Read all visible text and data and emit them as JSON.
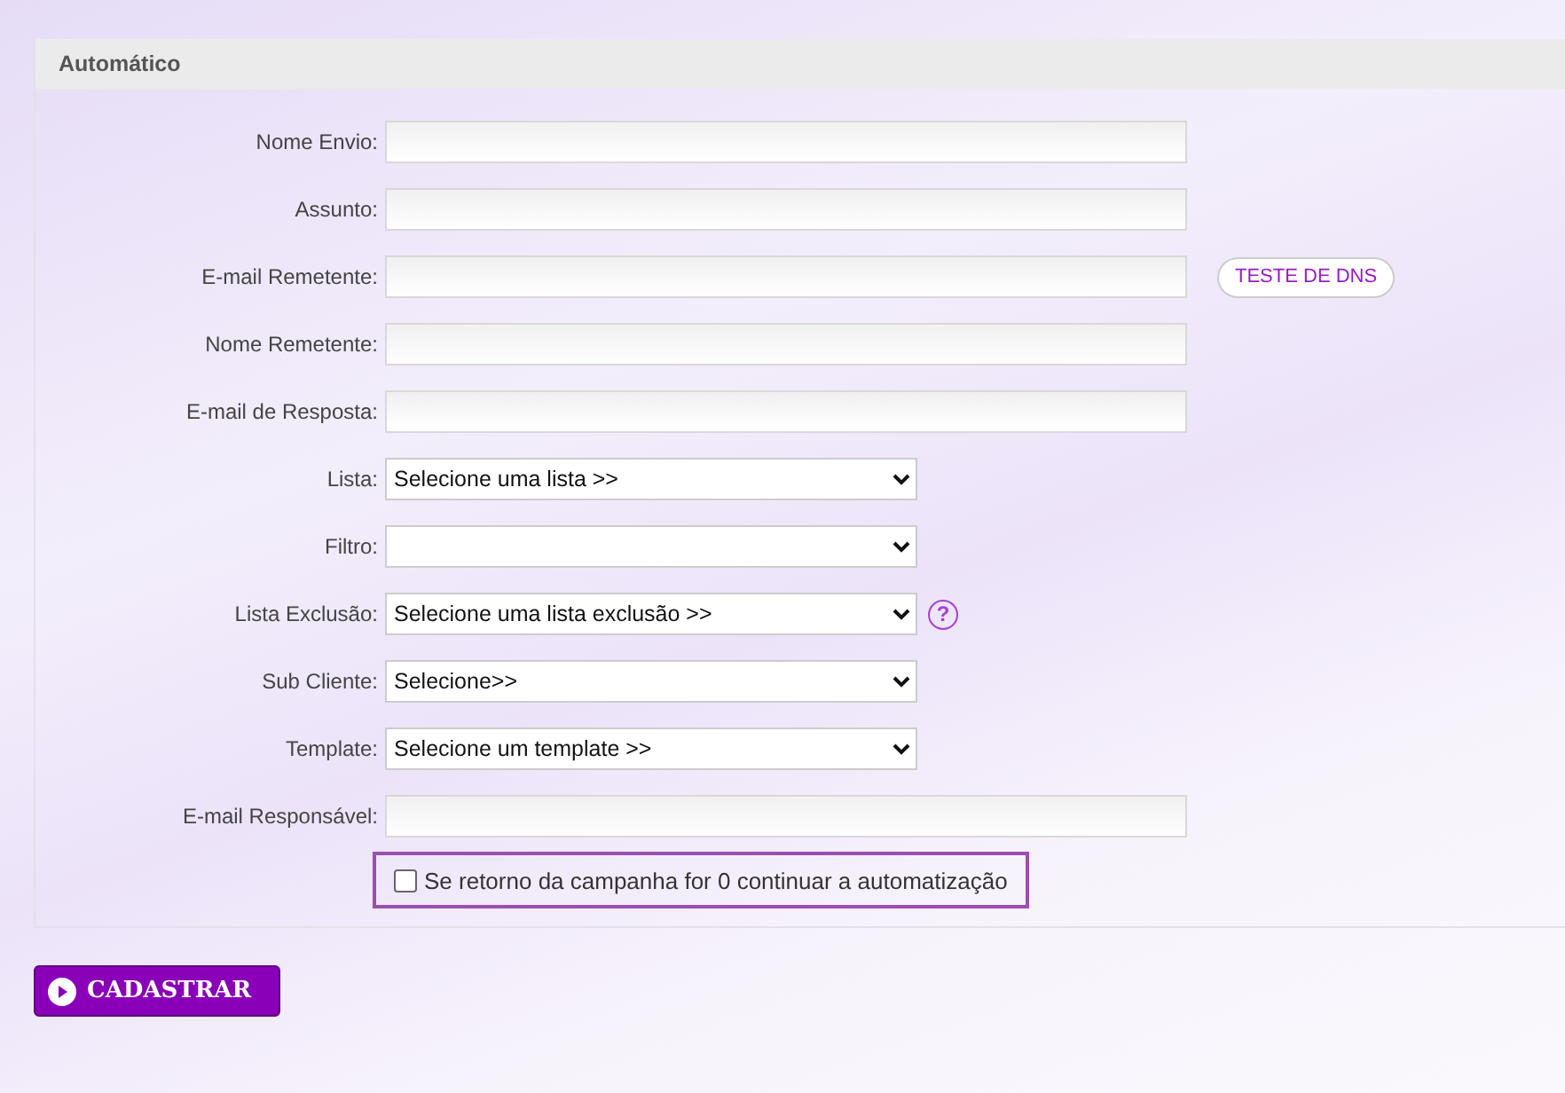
{
  "section": {
    "title": "Automático"
  },
  "fields": [
    {
      "label": "Nome Envio:",
      "kind": "text"
    },
    {
      "label": "Assunto:",
      "kind": "text"
    },
    {
      "label": "E-mail Remetente:",
      "kind": "text",
      "action": "TESTE DE DNS"
    },
    {
      "label": "Nome Remetente:",
      "kind": "text"
    },
    {
      "label": "E-mail de Resposta:",
      "kind": "text"
    },
    {
      "label": "Lista:",
      "kind": "select",
      "value": "Selecione uma lista >>"
    },
    {
      "label": "Filtro:",
      "kind": "select"
    },
    {
      "label": "Lista Exclusão:",
      "kind": "select",
      "value": "Selecione uma lista exclusão >>",
      "help": "?"
    },
    {
      "label": "Sub Cliente:",
      "kind": "select",
      "value": "Selecione>>"
    },
    {
      "label": "Template:",
      "kind": "select",
      "value": "Selecione um template >>"
    },
    {
      "label": "E-mail Responsável:",
      "kind": "text"
    }
  ],
  "checkbox": {
    "label": "Se retorno da campanha for 0 continuar a automatização",
    "checked": false
  },
  "submit": {
    "label": "CADASTRAR"
  }
}
